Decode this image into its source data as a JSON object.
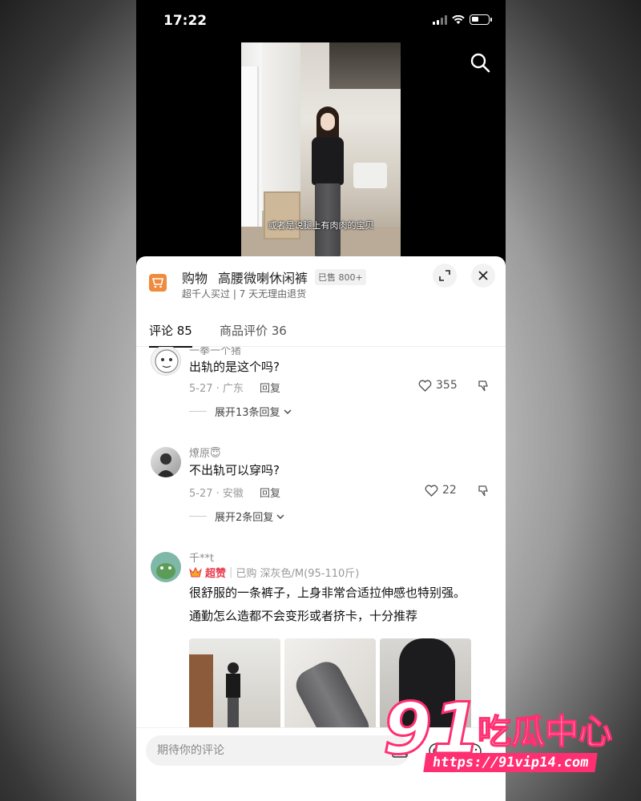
{
  "status_bar": {
    "time": "17:22"
  },
  "video": {
    "caption": "或者是说腿上有肉肉的宝贝"
  },
  "product": {
    "category": "购物",
    "name": "高腰微喇休闲裤",
    "sold": "已售 800+",
    "subtitle": "超千人买过 | 7 天无理由退货"
  },
  "tabs": [
    {
      "label": "评论 85",
      "active": true
    },
    {
      "label": "商品评价 36",
      "active": false
    }
  ],
  "comments": [
    {
      "user": "一拳一个猪",
      "text": "出轨的是这个吗?",
      "date_location": "5-27 · 广东",
      "reply_label": "回复",
      "likes": "355",
      "expand": "展开13条回复"
    },
    {
      "user": "燎原😇",
      "text": "不出轨可以穿吗?",
      "date_location": "5-27 · 安徽",
      "reply_label": "回复",
      "likes": "22",
      "expand": "展开2条回复"
    }
  ],
  "review": {
    "user": "千**t",
    "badge": "超赞",
    "purchase": "已购 深灰色/M(95-110斤)",
    "line1": "很舒服的一条裤子，上身非常合适拉伸感也特别强。",
    "line2": "通勤怎么造都不会变形或者挤卡，十分推荐"
  },
  "input": {
    "placeholder": "期待你的评论"
  },
  "watermark": {
    "number": "91",
    "brand": "吃瓜中心",
    "url": "https://91vip14.com"
  }
}
